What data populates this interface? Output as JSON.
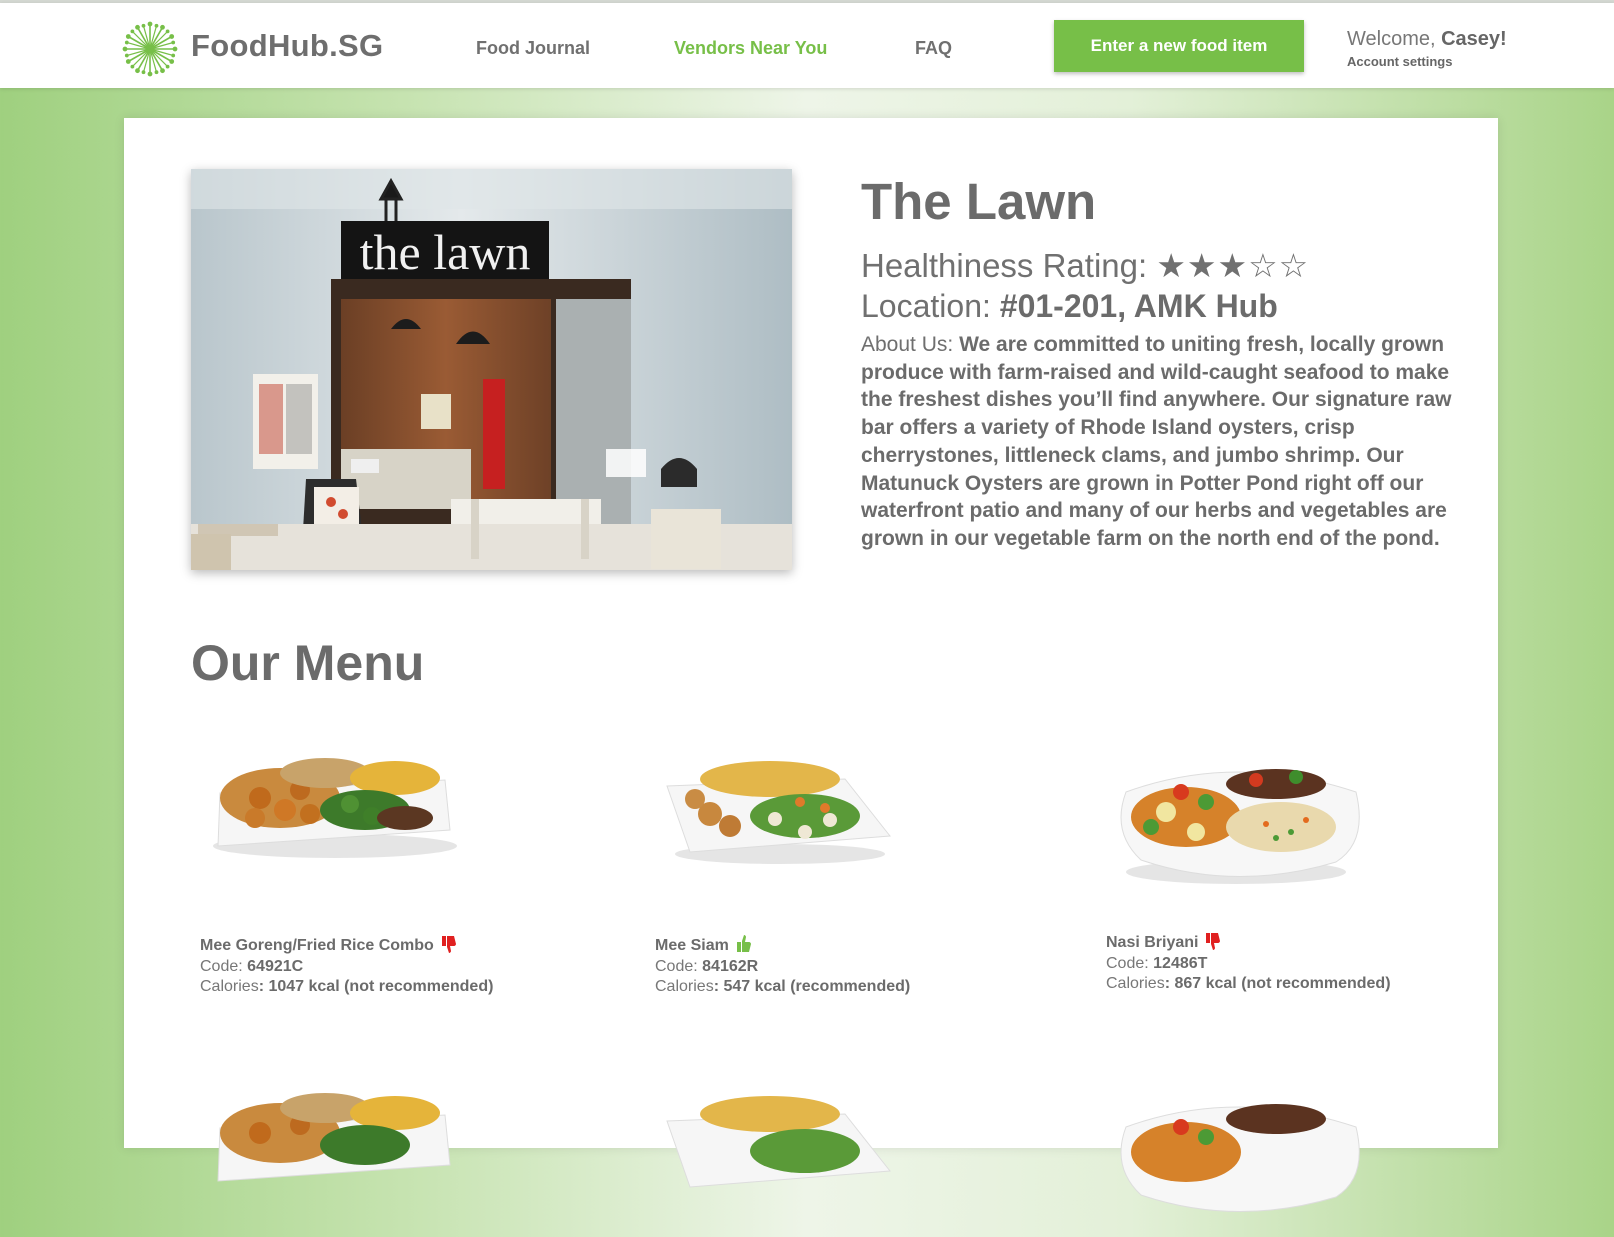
{
  "header": {
    "brand": "FoodHub.SG",
    "nav": [
      {
        "label": "Food Journal",
        "active": false
      },
      {
        "label": "Vendors Near You",
        "active": true
      },
      {
        "label": "FAQ",
        "active": false
      }
    ],
    "cta_label": "Enter a new food item",
    "welcome_prefix": "Welcome, ",
    "user_name": "Casey!",
    "account_label": "Account settings"
  },
  "vendor": {
    "photo_sign": "the lawn",
    "name": "The Lawn",
    "rating_label": "Healthiness Rating: ",
    "rating_stars": "★★★☆☆",
    "rating_value": 3,
    "rating_max": 5,
    "location_label": "Location: ",
    "location": "#01-201, AMK Hub",
    "about_label": "About Us: ",
    "about": "We are committed to uniting fresh, locally grown produce with farm-raised and wild-caught seafood to make the freshest dishes you’ll find anywhere. Our signature raw bar offers a variety of Rhode Island oysters, crisp cherrystones, littleneck clams, and jumbo shrimp. Our Matunuck Oysters are grown in Potter Pond right off our waterfront patio and many of our herbs and vegetables are grown in our vegetable farm on the north end of the pond."
  },
  "menu": {
    "title": "Our Menu",
    "code_label": "Code: ",
    "calories_label": "Calories",
    "items": [
      {
        "name": "Mee Goreng/Fried Rice Combo",
        "code": "64921C",
        "calories_text": ": 1047 kcal (not recommended)",
        "recommended": false
      },
      {
        "name": "Mee Siam",
        "code": "84162R",
        "calories_text": ": 547 kcal (recommended)",
        "recommended": true
      },
      {
        "name": "Nasi Briyani",
        "code": "12486T",
        "calories_text": ": 867 kcal (not recommended)",
        "recommended": false
      }
    ]
  },
  "colors": {
    "accent": "#77bf48",
    "text": "#707070",
    "thumbs_down": "#e02020"
  },
  "icons": [
    "logo-icon",
    "thumbs-up-icon",
    "thumbs-down-icon"
  ]
}
